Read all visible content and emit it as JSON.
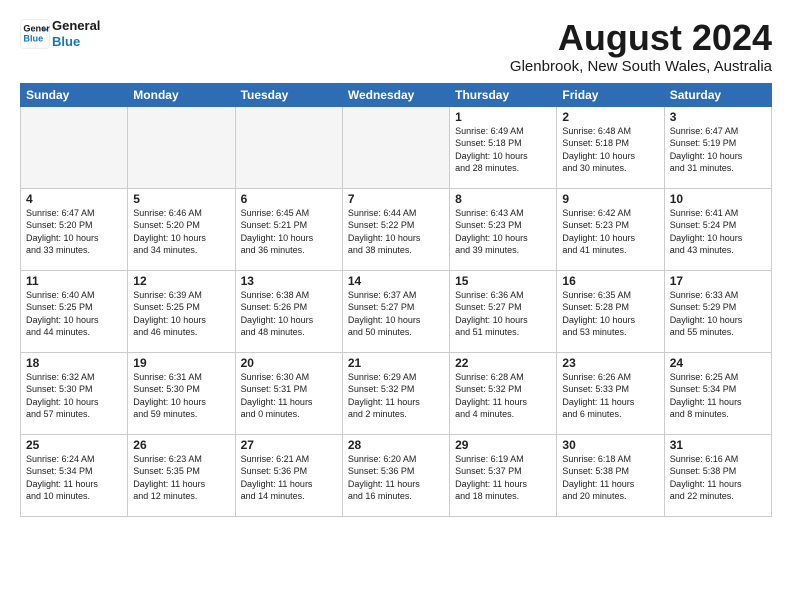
{
  "header": {
    "logo_line1": "General",
    "logo_line2": "Blue",
    "month_title": "August 2024",
    "location": "Glenbrook, New South Wales, Australia"
  },
  "weekdays": [
    "Sunday",
    "Monday",
    "Tuesday",
    "Wednesday",
    "Thursday",
    "Friday",
    "Saturday"
  ],
  "weeks": [
    [
      {
        "num": "",
        "info": ""
      },
      {
        "num": "",
        "info": ""
      },
      {
        "num": "",
        "info": ""
      },
      {
        "num": "",
        "info": ""
      },
      {
        "num": "1",
        "info": "Sunrise: 6:49 AM\nSunset: 5:18 PM\nDaylight: 10 hours\nand 28 minutes."
      },
      {
        "num": "2",
        "info": "Sunrise: 6:48 AM\nSunset: 5:18 PM\nDaylight: 10 hours\nand 30 minutes."
      },
      {
        "num": "3",
        "info": "Sunrise: 6:47 AM\nSunset: 5:19 PM\nDaylight: 10 hours\nand 31 minutes."
      }
    ],
    [
      {
        "num": "4",
        "info": "Sunrise: 6:47 AM\nSunset: 5:20 PM\nDaylight: 10 hours\nand 33 minutes."
      },
      {
        "num": "5",
        "info": "Sunrise: 6:46 AM\nSunset: 5:20 PM\nDaylight: 10 hours\nand 34 minutes."
      },
      {
        "num": "6",
        "info": "Sunrise: 6:45 AM\nSunset: 5:21 PM\nDaylight: 10 hours\nand 36 minutes."
      },
      {
        "num": "7",
        "info": "Sunrise: 6:44 AM\nSunset: 5:22 PM\nDaylight: 10 hours\nand 38 minutes."
      },
      {
        "num": "8",
        "info": "Sunrise: 6:43 AM\nSunset: 5:23 PM\nDaylight: 10 hours\nand 39 minutes."
      },
      {
        "num": "9",
        "info": "Sunrise: 6:42 AM\nSunset: 5:23 PM\nDaylight: 10 hours\nand 41 minutes."
      },
      {
        "num": "10",
        "info": "Sunrise: 6:41 AM\nSunset: 5:24 PM\nDaylight: 10 hours\nand 43 minutes."
      }
    ],
    [
      {
        "num": "11",
        "info": "Sunrise: 6:40 AM\nSunset: 5:25 PM\nDaylight: 10 hours\nand 44 minutes."
      },
      {
        "num": "12",
        "info": "Sunrise: 6:39 AM\nSunset: 5:25 PM\nDaylight: 10 hours\nand 46 minutes."
      },
      {
        "num": "13",
        "info": "Sunrise: 6:38 AM\nSunset: 5:26 PM\nDaylight: 10 hours\nand 48 minutes."
      },
      {
        "num": "14",
        "info": "Sunrise: 6:37 AM\nSunset: 5:27 PM\nDaylight: 10 hours\nand 50 minutes."
      },
      {
        "num": "15",
        "info": "Sunrise: 6:36 AM\nSunset: 5:27 PM\nDaylight: 10 hours\nand 51 minutes."
      },
      {
        "num": "16",
        "info": "Sunrise: 6:35 AM\nSunset: 5:28 PM\nDaylight: 10 hours\nand 53 minutes."
      },
      {
        "num": "17",
        "info": "Sunrise: 6:33 AM\nSunset: 5:29 PM\nDaylight: 10 hours\nand 55 minutes."
      }
    ],
    [
      {
        "num": "18",
        "info": "Sunrise: 6:32 AM\nSunset: 5:30 PM\nDaylight: 10 hours\nand 57 minutes."
      },
      {
        "num": "19",
        "info": "Sunrise: 6:31 AM\nSunset: 5:30 PM\nDaylight: 10 hours\nand 59 minutes."
      },
      {
        "num": "20",
        "info": "Sunrise: 6:30 AM\nSunset: 5:31 PM\nDaylight: 11 hours\nand 0 minutes."
      },
      {
        "num": "21",
        "info": "Sunrise: 6:29 AM\nSunset: 5:32 PM\nDaylight: 11 hours\nand 2 minutes."
      },
      {
        "num": "22",
        "info": "Sunrise: 6:28 AM\nSunset: 5:32 PM\nDaylight: 11 hours\nand 4 minutes."
      },
      {
        "num": "23",
        "info": "Sunrise: 6:26 AM\nSunset: 5:33 PM\nDaylight: 11 hours\nand 6 minutes."
      },
      {
        "num": "24",
        "info": "Sunrise: 6:25 AM\nSunset: 5:34 PM\nDaylight: 11 hours\nand 8 minutes."
      }
    ],
    [
      {
        "num": "25",
        "info": "Sunrise: 6:24 AM\nSunset: 5:34 PM\nDaylight: 11 hours\nand 10 minutes."
      },
      {
        "num": "26",
        "info": "Sunrise: 6:23 AM\nSunset: 5:35 PM\nDaylight: 11 hours\nand 12 minutes."
      },
      {
        "num": "27",
        "info": "Sunrise: 6:21 AM\nSunset: 5:36 PM\nDaylight: 11 hours\nand 14 minutes."
      },
      {
        "num": "28",
        "info": "Sunrise: 6:20 AM\nSunset: 5:36 PM\nDaylight: 11 hours\nand 16 minutes."
      },
      {
        "num": "29",
        "info": "Sunrise: 6:19 AM\nSunset: 5:37 PM\nDaylight: 11 hours\nand 18 minutes."
      },
      {
        "num": "30",
        "info": "Sunrise: 6:18 AM\nSunset: 5:38 PM\nDaylight: 11 hours\nand 20 minutes."
      },
      {
        "num": "31",
        "info": "Sunrise: 6:16 AM\nSunset: 5:38 PM\nDaylight: 11 hours\nand 22 minutes."
      }
    ]
  ]
}
